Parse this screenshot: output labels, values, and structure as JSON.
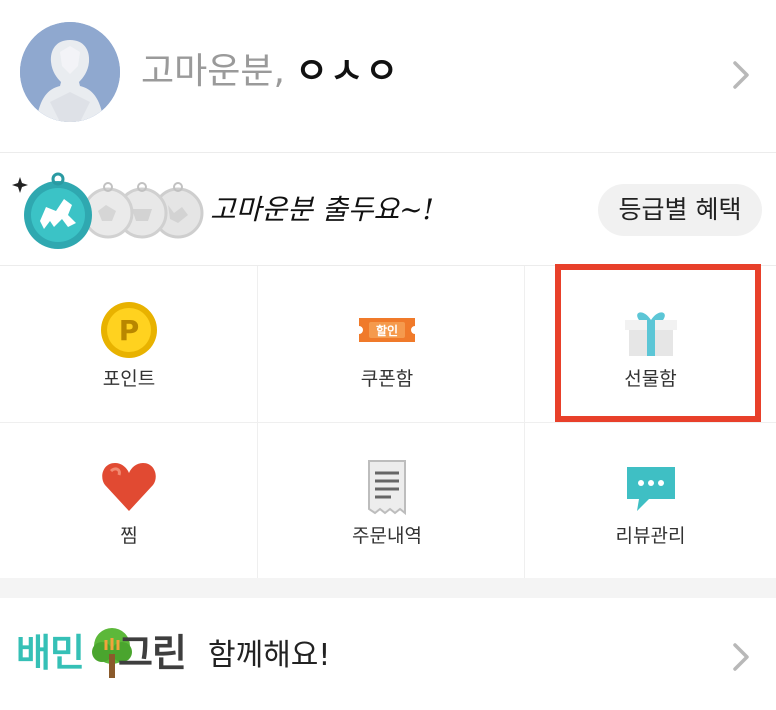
{
  "profile": {
    "greeting": "고마운분,",
    "nickname": "ㅇㅅㅇ"
  },
  "grade": {
    "message": "고마운분 출두요~!",
    "benefit_button": "등급별 혜택"
  },
  "menu": {
    "items": [
      {
        "label": "포인트",
        "icon": "point-coin-icon"
      },
      {
        "label": "쿠폰함",
        "icon": "coupon-ticket-icon"
      },
      {
        "label": "선물함",
        "icon": "gift-box-icon"
      },
      {
        "label": "찜",
        "icon": "heart-icon"
      },
      {
        "label": "주문내역",
        "icon": "receipt-icon"
      },
      {
        "label": "리뷰관리",
        "icon": "speech-bubble-icon"
      }
    ],
    "highlighted": "선물함",
    "highlight_color": "#e8402a"
  },
  "banner": {
    "logo_part1": "배민",
    "logo_part2": "그린",
    "text": "함께해요!",
    "logo_color": "#35c0b6"
  }
}
